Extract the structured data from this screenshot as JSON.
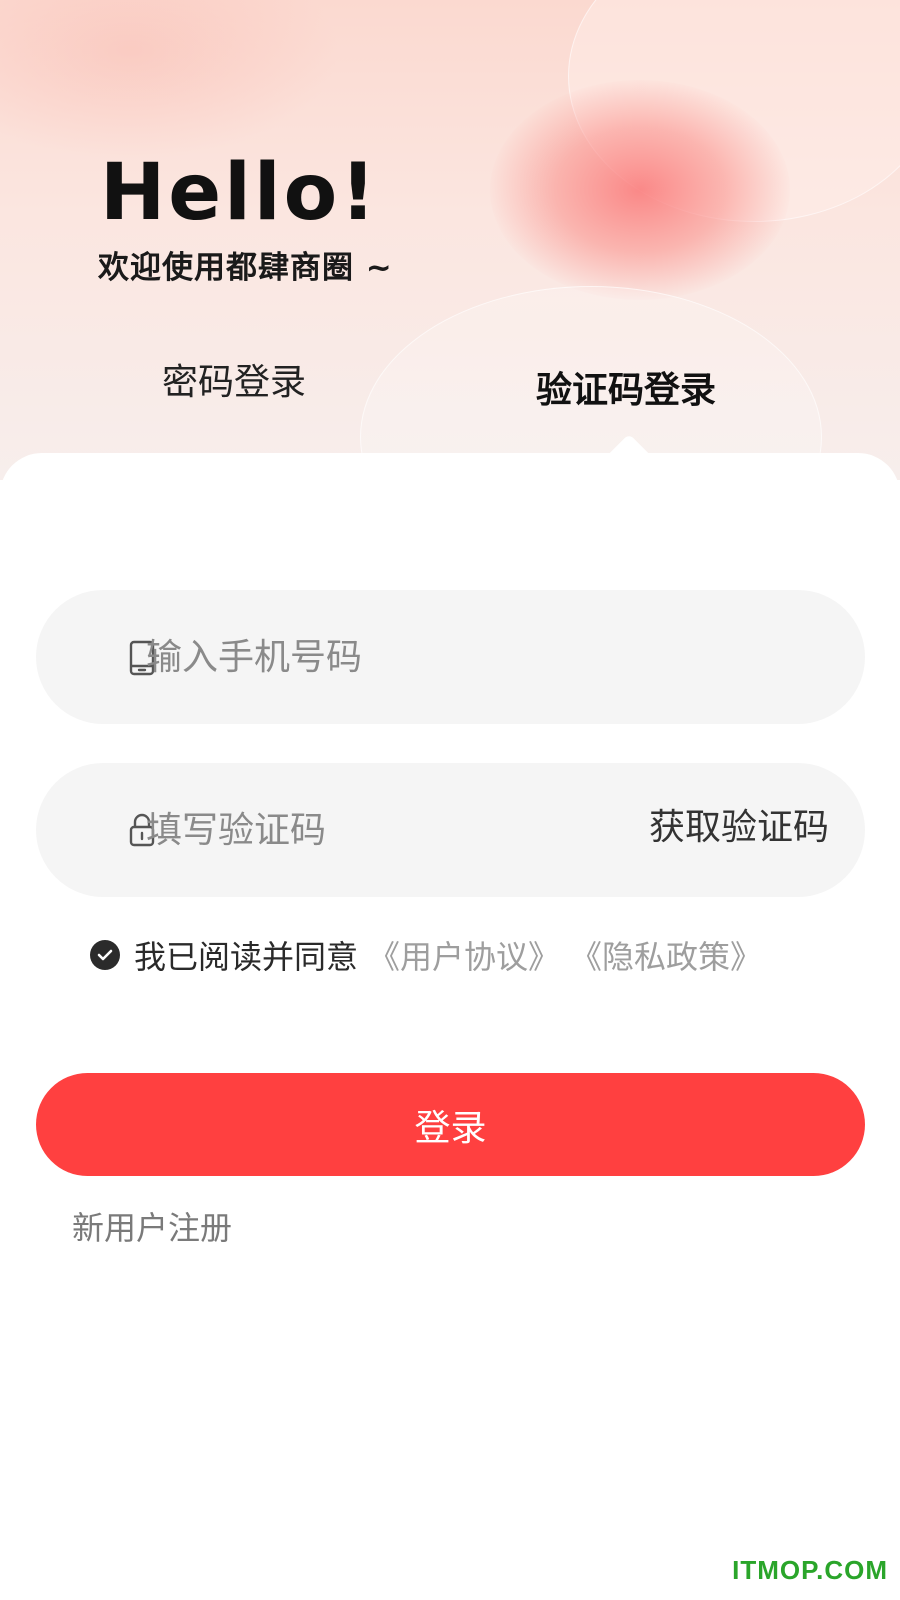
{
  "hero": {
    "greeting": "Hello!",
    "welcome": "欢迎使用都肆商圈 ~"
  },
  "tabs": {
    "password_login": "密码登录",
    "code_login": "验证码登录",
    "active": "code_login"
  },
  "form": {
    "phone": {
      "icon": "phone-icon",
      "placeholder": "输入手机号码",
      "value": ""
    },
    "code": {
      "icon": "lock-icon",
      "placeholder": "填写验证码",
      "value": "",
      "get_code_label": "获取验证码"
    }
  },
  "agreement": {
    "checked": true,
    "text": "我已阅读并同意",
    "user_agreement": "《用户协议》",
    "privacy_policy": "《隐私政策》"
  },
  "login_button": "登录",
  "register_link": "新用户注册",
  "watermark": "ITMOP.COM",
  "colors": {
    "primary": "#ff4040",
    "link_gray": "#9e9e9e",
    "field_bg": "#f5f5f5",
    "watermark_green": "#2aa52a"
  }
}
